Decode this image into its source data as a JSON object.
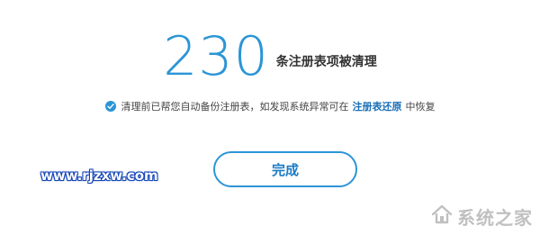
{
  "result": {
    "count": "230",
    "count_label": "条注册表项被清理"
  },
  "info": {
    "text_before": "清理前已帮您自动备份注册表，如发现系统异常可在",
    "link_text": "注册表还原",
    "text_after": "中恢复"
  },
  "actions": {
    "done_label": "完成"
  },
  "watermarks": {
    "site": "www.rjzxw.com",
    "logo": "系统之家"
  },
  "colors": {
    "accent": "#2b95d6",
    "link": "#1a6fb8"
  }
}
